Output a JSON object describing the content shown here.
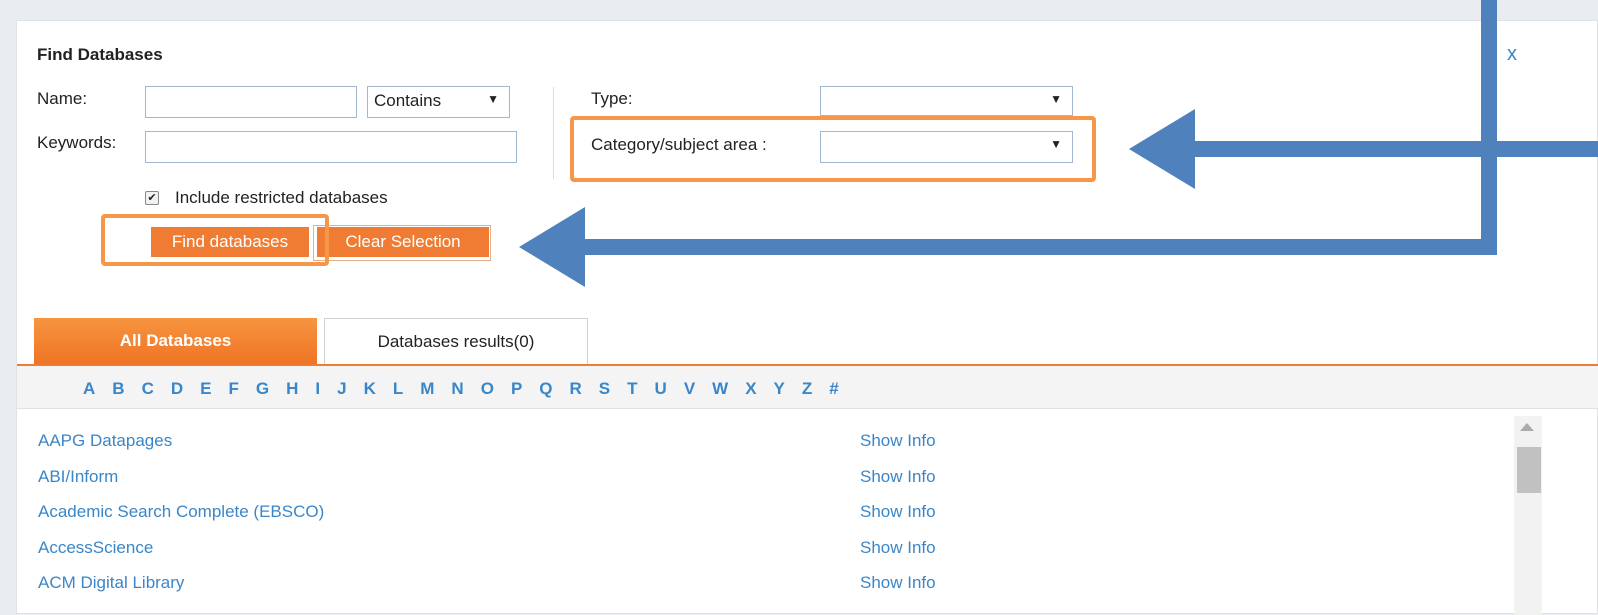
{
  "dialog": {
    "title": "Find Databases",
    "close_label": "x"
  },
  "form": {
    "name_label": "Name:",
    "name_value": "",
    "match_select": "Contains",
    "keywords_label": "Keywords:",
    "keywords_value": "",
    "type_label": "Type:",
    "type_value": "",
    "category_label": "Category/subject area :",
    "category_value": "",
    "restricted_label": "Include restricted databases",
    "restricted_checked": true,
    "find_button": "Find databases",
    "clear_button": "Clear Selection"
  },
  "tabs": [
    {
      "label": "All Databases",
      "active": true
    },
    {
      "label": "Databases results(0)",
      "active": false
    }
  ],
  "letters": [
    "A",
    "B",
    "C",
    "D",
    "E",
    "F",
    "G",
    "H",
    "I",
    "J",
    "K",
    "L",
    "M",
    "N",
    "O",
    "P",
    "Q",
    "R",
    "S",
    "T",
    "U",
    "V",
    "W",
    "X",
    "Y",
    "Z",
    "#"
  ],
  "databases": [
    {
      "name": "AAPG Datapages",
      "action": "Show Info"
    },
    {
      "name": "ABI/Inform",
      "action": "Show Info"
    },
    {
      "name": "Academic Search Complete (EBSCO)",
      "action": "Show Info"
    },
    {
      "name": "AccessScience",
      "action": "Show Info"
    },
    {
      "name": "ACM Digital Library",
      "action": "Show Info"
    }
  ],
  "colors": {
    "accent": "#f07c33",
    "highlight": "#f79646",
    "link": "#3a86c8",
    "annotation_arrow": "#4f81bd"
  },
  "icons": {
    "dropdown": "triangle-down-icon",
    "checkbox": "check-icon",
    "scroll_up": "triangle-up-icon"
  }
}
